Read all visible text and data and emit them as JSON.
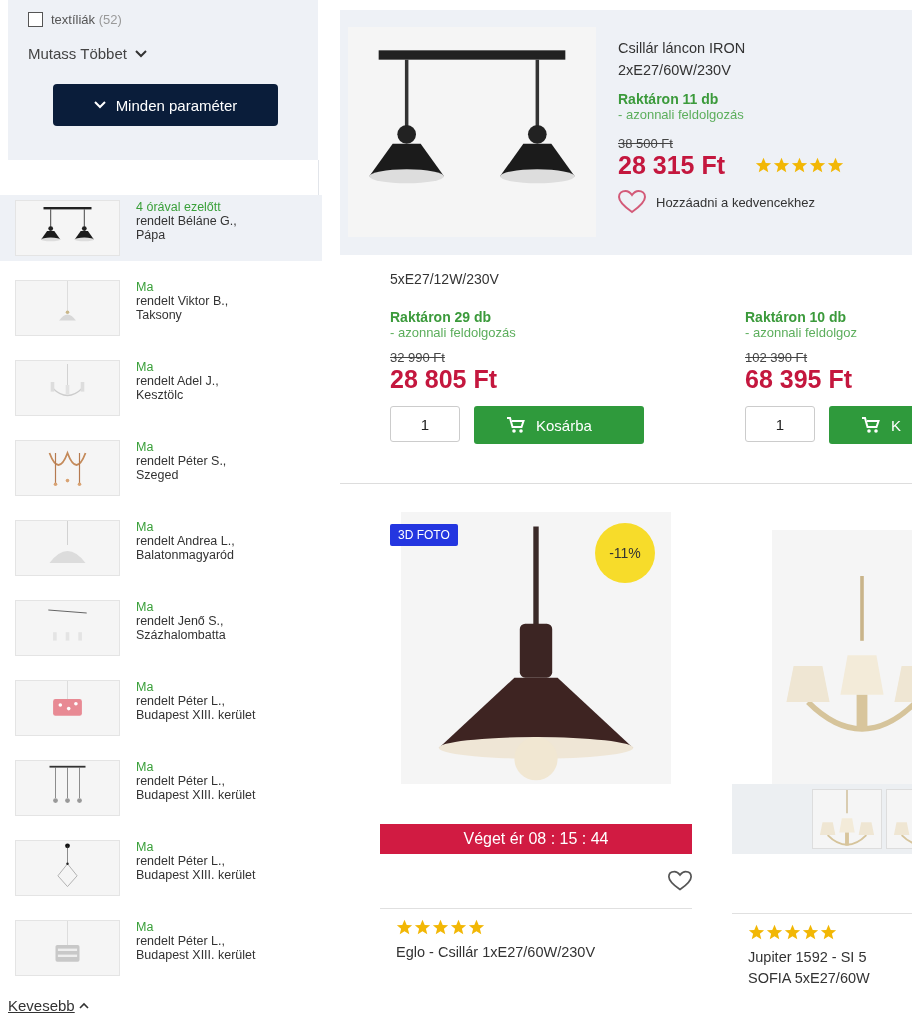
{
  "filters": {
    "option": {
      "label": "textíliák",
      "count": "(52)",
      "checked": false
    },
    "show_more": "Mutass Többet",
    "all_params_button": "Minden paraméter"
  },
  "recent_orders": [
    {
      "time": "4 órával ezelőtt",
      "buyer": "rendelt Béláne G.,",
      "city": "Pápa",
      "highlighted": true
    },
    {
      "time": "Ma",
      "buyer": "rendelt Viktor B.,",
      "city": "Taksony",
      "highlighted": false
    },
    {
      "time": "Ma",
      "buyer": "rendelt Adel J.,",
      "city": "Kesztölc",
      "highlighted": false
    },
    {
      "time": "Ma",
      "buyer": "rendelt Péter S.,",
      "city": "Szeged",
      "highlighted": false
    },
    {
      "time": "Ma",
      "buyer": "rendelt Andrea L.,",
      "city": "Balatonmagyaród",
      "highlighted": false
    },
    {
      "time": "Ma",
      "buyer": "rendelt Jenő S.,",
      "city": "Százhalombatta",
      "highlighted": false
    },
    {
      "time": "Ma",
      "buyer": "rendelt Péter L.,",
      "city": "Budapest XIII. kerület",
      "highlighted": false
    },
    {
      "time": "Ma",
      "buyer": "rendelt Péter L.,",
      "city": "Budapest XIII. kerület",
      "highlighted": false
    },
    {
      "time": "Ma",
      "buyer": "rendelt Péter L.,",
      "city": "Budapest XIII. kerület",
      "highlighted": false
    },
    {
      "time": "Ma",
      "buyer": "rendelt Péter L.,",
      "city": "Budapest XIII. kerület",
      "highlighted": false
    }
  ],
  "less_link": "Kevesebb",
  "popup_product": {
    "title": "Csillár láncon IRON 2xE27/60W/230V",
    "stock": "Raktáron 11 db",
    "processing": "- azonnali feldolgozás",
    "old_price": "38 500 Ft",
    "price": "28 315 Ft",
    "stars": 5,
    "favorite": "Hozzáadni a kedvencekhez"
  },
  "listing_cards": [
    {
      "title": "5xE27/12W/230V",
      "stock": "Raktáron 29 db",
      "processing": "- azonnali feldolgozás",
      "old_price": "32 990 Ft",
      "price": "28 805 Ft",
      "quantity": "1",
      "cart_button": "Kosárba"
    },
    {
      "stock": "Raktáron 10 db",
      "processing": "- azonnali feldolgoz",
      "old_price": "102 390 Ft",
      "price": "68 395 Ft",
      "quantity": "1",
      "cart_button": "K"
    }
  ],
  "product_cards": [
    {
      "badge": "3D FOTO",
      "discount": "-11%",
      "countdown": "Véget ér 08 : 15 : 44",
      "stars": 5,
      "title_lines": [
        "Eglo - Csillár 1xE27/60W/230V"
      ]
    },
    {
      "stars": 5,
      "title_lines": [
        "Jupiter 1592 - SI 5",
        "SOFIA 5xE27/60W"
      ]
    }
  ]
}
